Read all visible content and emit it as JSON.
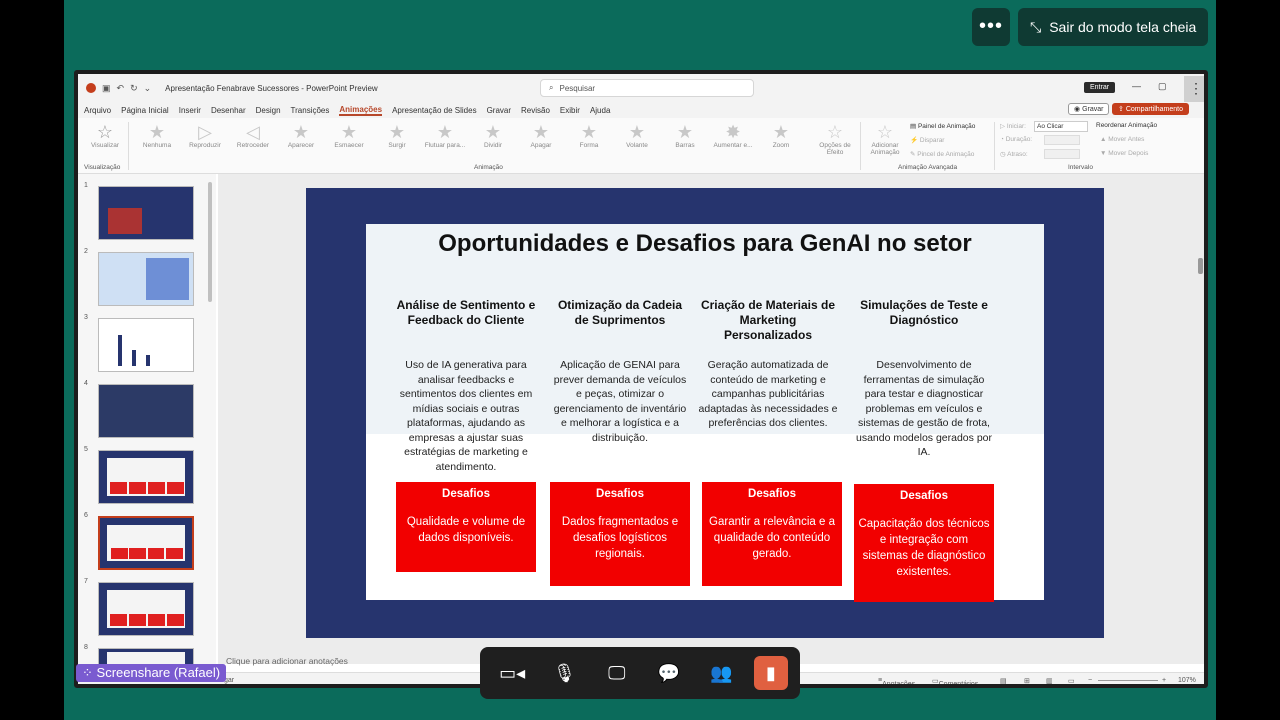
{
  "meeting": {
    "exit_fullscreen_label": "Sair do modo tela cheia",
    "more_icon": "more-icon",
    "screenshare_label": "Screenshare (Rafael)"
  },
  "app": {
    "title": "Apresentação Fenabrave Sucessores  -  PowerPoint Preview",
    "search_placeholder": "Pesquisar",
    "signin_label": "Entrar",
    "save_label": "Gravar",
    "share_label": "Compartilhamento"
  },
  "menu": [
    "Arquivo",
    "Página Inicial",
    "Inserir",
    "Desenhar",
    "Design",
    "Transições",
    "Animações",
    "Apresentação de Slides",
    "Gravar",
    "Revisão",
    "Exibir",
    "Ajuda"
  ],
  "menu_active_index": 6,
  "ribbon": {
    "preview_label": "Visualizar",
    "preview_group": "Visualização",
    "animations": [
      "Nenhuma",
      "Reproduzir",
      "Retroceder",
      "Aparecer",
      "Esmaecer",
      "Surgir",
      "Flutuar para...",
      "Dividir",
      "Apagar",
      "Forma",
      "Volante",
      "Barras",
      "Aumentar e...",
      "Zoom"
    ],
    "effect_options": "Opções de Efeito",
    "animation_group": "Animação",
    "add_animation": "Adicionar Animação",
    "anim_pane": "Painel de Animação",
    "trigger": "Disparar",
    "painter": "Pincel de Animação",
    "advanced_group": "Animação Avançada",
    "start_label": "Iniciar:",
    "start_value": "Ao Clicar",
    "duration_label": "Duração:",
    "delay_label": "Atraso:",
    "timing_group": "Intervalo",
    "reorder_label": "Reordenar Animação",
    "move_earlier": "Mover Antes",
    "move_later": "Mover Depois"
  },
  "thumbnails": [
    {
      "num": "1"
    },
    {
      "num": "2"
    },
    {
      "num": "3"
    },
    {
      "num": "4"
    },
    {
      "num": "5"
    },
    {
      "num": "6"
    },
    {
      "num": "7"
    },
    {
      "num": "8"
    }
  ],
  "selected_slide": 6,
  "slide": {
    "title": "Oportunidades e Desafios para GenAI no setor",
    "columns": [
      {
        "heading": "Análise de Sentimento e Feedback do Cliente",
        "body": "Uso de IA generativa para analisar feedbacks e sentimentos dos clientes em mídias sociais e outras plataformas, ajudando as empresas a ajustar suas estratégias de marketing e atendimento.",
        "challenge_title": "Desafios",
        "challenge_text": "Qualidade e volume de dados disponíveis."
      },
      {
        "heading": "Otimização da Cadeia de Suprimentos",
        "body": "Aplicação de GENAI para prever demanda de veículos e peças, otimizar o gerenciamento de inventário e melhorar a logística e a distribuição.",
        "challenge_title": "Desafios",
        "challenge_text": "Dados fragmentados e desafios logísticos regionais."
      },
      {
        "heading": "Criação de Materiais de Marketing Personalizados",
        "body": "Geração automatizada de conteúdo de marketing e campanhas publicitárias adaptadas às necessidades e preferências dos clientes.",
        "challenge_title": "Desafios",
        "challenge_text": "Garantir a relevância e a qualidade do conteúdo gerado."
      },
      {
        "heading": "Simulações de Teste e Diagnóstico",
        "body": "Desenvolvimento de ferramentas de simulação para testar e diagnosticar problemas em veículos e sistemas de gestão de frota, usando modelos gerados por IA.",
        "challenge_title": "Desafios",
        "challenge_text": "Capacitação dos técnicos e integração com sistemas de diagnóstico existentes."
      }
    ]
  },
  "notes_placeholder": "Clique para adicionar anotações",
  "status": {
    "left": "gar",
    "notes_label": "Anotações",
    "comments_label": "Comentários",
    "zoom": "107%"
  },
  "colors": {
    "accent": "#c43e1c",
    "slide_bg": "#26346e",
    "challenge_red": "#f20000",
    "teal": "#0b6b5b"
  }
}
